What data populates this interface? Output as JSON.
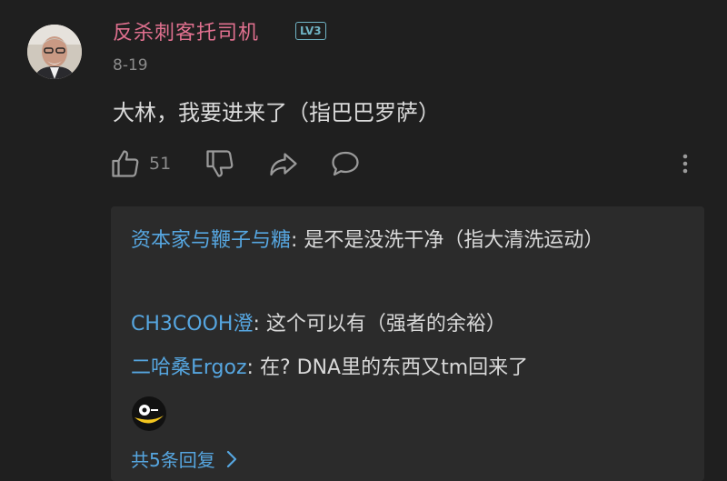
{
  "comment": {
    "username": "反杀刺客托司机",
    "level": "LV3",
    "date": "8-19",
    "text": "大林，我要进来了（指巴巴罗萨）",
    "like_count": "51"
  },
  "icons": {
    "like": "thumbs-up-icon",
    "dislike": "thumbs-down-icon",
    "share": "share-icon",
    "reply": "comment-icon",
    "more": "more-vertical-icon"
  },
  "replies": [
    {
      "name": "资本家与鞭子与糖",
      "sep": ": ",
      "text": "是不是没洗干净（指大清洗运动）"
    },
    {
      "name": "CH3COOH澄",
      "sep": ": ",
      "text": "这个可以有（强者的余裕）"
    },
    {
      "name": "二哈桑Ergoz",
      "sep": ": ",
      "text": "在? DNA里的东西又tm回来了"
    }
  ],
  "view_all": "共5条回复",
  "colors": {
    "username": "#e0708f",
    "level_badge": "#6fb3c4",
    "link": "#56a6e0",
    "background": "#1f1f1f",
    "reply_box": "#2b2b2b"
  }
}
